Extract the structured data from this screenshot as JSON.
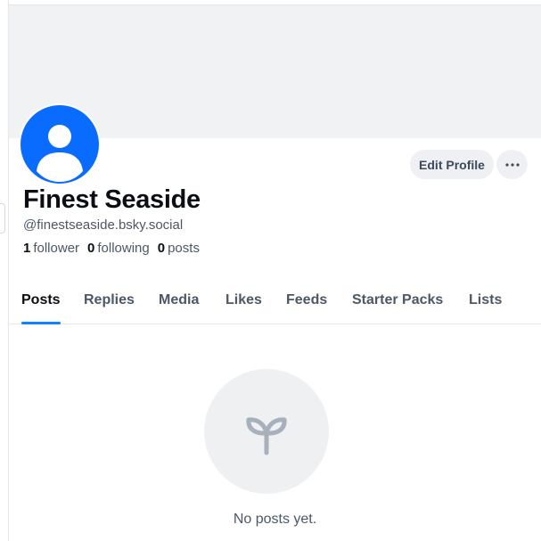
{
  "profile": {
    "display_name": "Finest Seaside",
    "handle": "@finestseaside.bsky.social",
    "stats": {
      "followers_count": "1",
      "followers_label": "follower",
      "following_count": "0",
      "following_label": "following",
      "posts_count": "0",
      "posts_label": "posts"
    },
    "avatar_color": "#0a6cff",
    "avatar_icon": "default-user-avatar-icon"
  },
  "actions": {
    "edit_profile_label": "Edit Profile",
    "more_icon": "ellipsis-icon"
  },
  "tabs": [
    {
      "label": "Posts",
      "active": true
    },
    {
      "label": "Replies",
      "active": false
    },
    {
      "label": "Media",
      "active": false
    },
    {
      "label": "Likes",
      "active": false
    },
    {
      "label": "Feeds",
      "active": false
    },
    {
      "label": "Starter Packs",
      "active": false
    },
    {
      "label": "Lists",
      "active": false
    }
  ],
  "empty_state": {
    "icon": "seedling-icon",
    "message": "No posts yet."
  },
  "colors": {
    "accent": "#1083fe",
    "banner": "#f1f2f4",
    "muted_text": "#4b5866"
  }
}
